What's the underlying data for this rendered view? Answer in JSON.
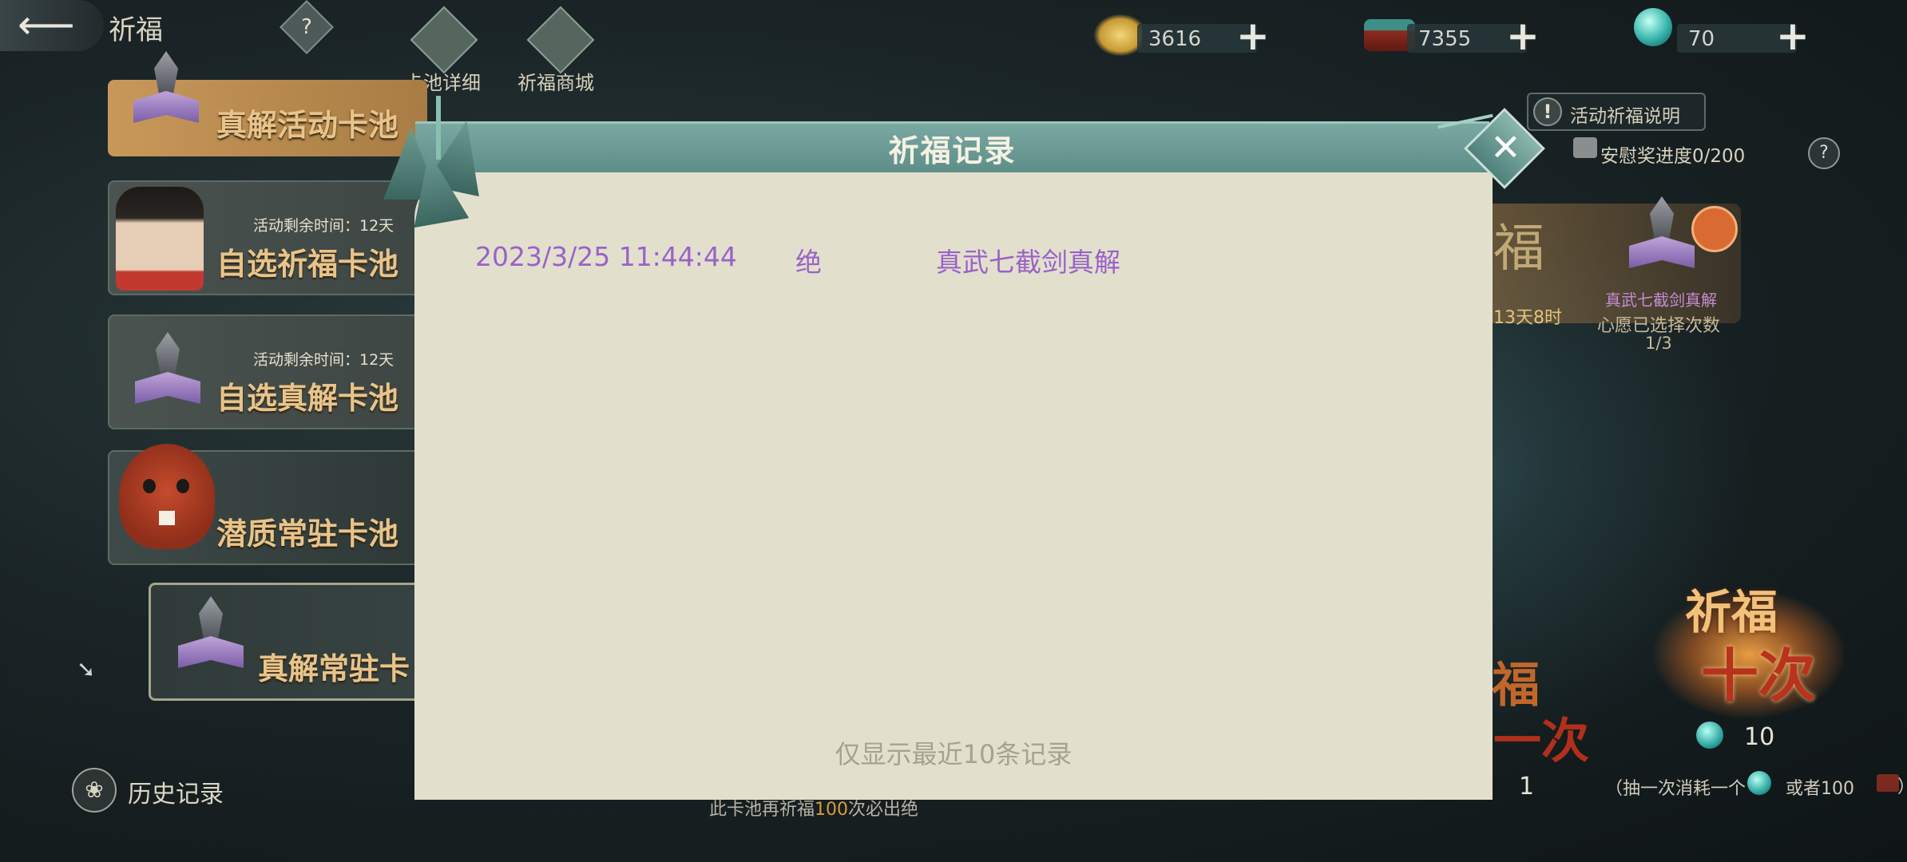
{
  "header": {
    "title": "祈福",
    "help": "?",
    "tabs": [
      {
        "label": "卡池详细",
        "icon": "cards-icon"
      },
      {
        "label": "祈福商城",
        "icon": "orb-shop-icon"
      }
    ]
  },
  "currencies": [
    {
      "icon": "gold-ingot-icon",
      "value": "3616",
      "plus": "+"
    },
    {
      "icon": "treasure-chest-icon",
      "value": "7355",
      "plus": "+"
    },
    {
      "icon": "jade-orb-icon",
      "value": "70",
      "plus": "+"
    }
  ],
  "right_panel": {
    "info_button": "活动祈福说明",
    "info_icon": "!",
    "consolation": "安慰奖进度0/200",
    "help": "?",
    "banner_title_fragment": "福",
    "time_fragment": "13天8时",
    "selected_book": "真武七截剑真解",
    "wish_selected_label": "心愿已选择次数",
    "wish_selected_count": "1/3",
    "draw_ten_line1": "祈福",
    "draw_ten_line2": "十次",
    "draw_ten_cost": "10",
    "draw_one_fragment1": "福",
    "draw_one_fragment2": "一次",
    "draw_one_cost": "1",
    "cost_note_start": "（抽一次消耗一个",
    "cost_note_mid": "或者100",
    "cost_note_end": "）"
  },
  "pools": [
    {
      "name": "真解活动卡池",
      "remain": ""
    },
    {
      "name": "自选祈福卡池",
      "remain": "活动剩余时间：12天"
    },
    {
      "name": "自选真解卡池",
      "remain": "活动剩余时间：12天"
    },
    {
      "name": "潜质常驻卡池",
      "remain": ""
    },
    {
      "name": "真解常驻卡",
      "remain": ""
    }
  ],
  "history_label": "历史记录",
  "bottom_hint_prefix": "此卡池再祈福",
  "bottom_hint_count": "100",
  "bottom_hint_suffix": "次必出绝",
  "modal": {
    "title": "祈福记录",
    "close": "✕",
    "records": [
      {
        "time": "2023/3/25 11:44:44",
        "rank": "绝",
        "item": "真武七截剑真解"
      }
    ],
    "footer": "仅显示最近10条记录"
  },
  "colors": {
    "record_text": "#9a62c9",
    "modal_body": "#e2e0cd",
    "modal_header": "#6a9a94",
    "pool_name": "#e8c48a"
  }
}
